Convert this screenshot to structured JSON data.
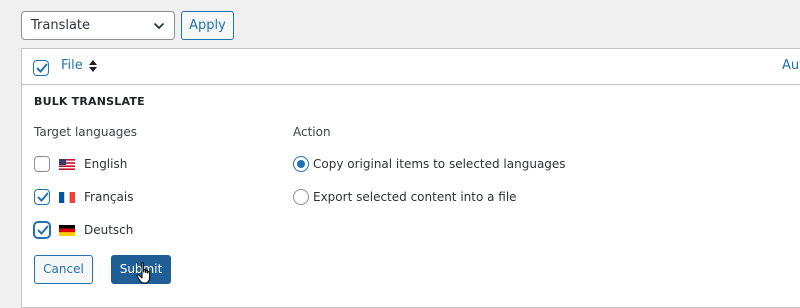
{
  "bulk_actions": {
    "selected": "Translate",
    "apply_label": "Apply"
  },
  "table": {
    "columns": [
      {
        "label": "File"
      },
      {
        "label": "Aut"
      }
    ],
    "select_all_checked": true
  },
  "bulk_translate": {
    "title": "BULK TRANSLATE",
    "target_label": "Target languages",
    "action_label": "Action",
    "languages": [
      {
        "name": "English",
        "flag": "us-flag",
        "checked": false
      },
      {
        "name": "Français",
        "flag": "fr-flag",
        "checked": true
      },
      {
        "name": "Deutsch",
        "flag": "de-flag",
        "checked": true
      }
    ],
    "actions": [
      {
        "label": "Copy original items to selected languages",
        "selected": true
      },
      {
        "label": "Export selected content into a file",
        "selected": false
      }
    ],
    "cancel_label": "Cancel",
    "submit_label": "Submit"
  },
  "colors": {
    "accent": "#2271b1",
    "submit_bg": "#1f5f95",
    "background": "#f0f0f1"
  }
}
